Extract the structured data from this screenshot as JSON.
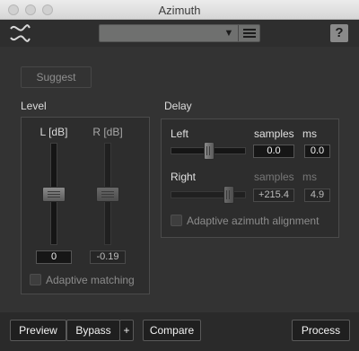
{
  "window": {
    "title": "Azimuth"
  },
  "header": {
    "preset_value": "",
    "help_label": "?"
  },
  "suggest_label": "Suggest",
  "level": {
    "section_label": "Level",
    "left": {
      "label": "L [dB]",
      "value": "0",
      "level_db": 0
    },
    "right": {
      "label": "R [dB]",
      "value": "-0.19",
      "level_db": -0.19
    },
    "adaptive_label": "Adaptive matching"
  },
  "delay": {
    "section_label": "Delay",
    "left": {
      "label": "Left",
      "samples_label": "samples",
      "ms_label": "ms",
      "samples_value": "0.0",
      "ms_value": "0.0"
    },
    "right": {
      "label": "Right",
      "samples_label": "samples",
      "ms_label": "ms",
      "samples_value": "+215.4",
      "ms_value": "4.9"
    },
    "adaptive_label": "Adaptive azimuth alignment"
  },
  "footer": {
    "preview_label": "Preview",
    "bypass_label": "Bypass",
    "plus_label": "+",
    "compare_label": "Compare",
    "process_label": "Process"
  }
}
